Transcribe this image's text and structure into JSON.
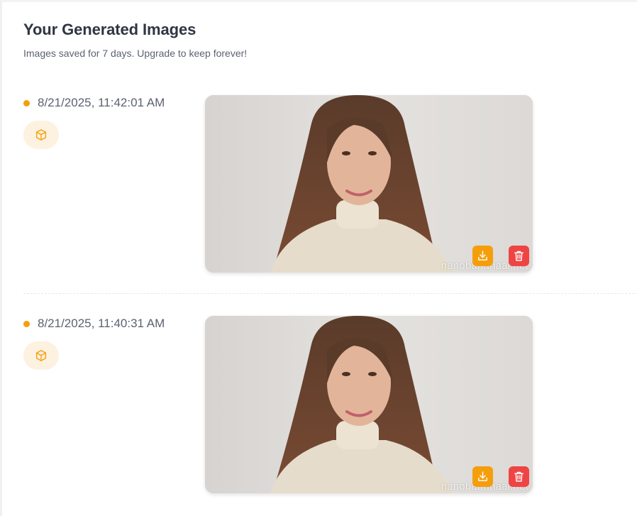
{
  "header": {
    "title": "Your Generated Images",
    "subtitle": "Images saved for 7 days. Upgrade to keep forever!"
  },
  "entries": [
    {
      "timestamp": "8/21/2025, 11:42:01 AM",
      "model_icon": "cube-icon",
      "watermark": "nanobananaai.net",
      "actions": {
        "download_icon": "download-icon",
        "delete_icon": "trash-icon"
      }
    },
    {
      "timestamp": "8/21/2025, 11:40:31 AM",
      "model_icon": "cube-icon",
      "watermark": "nanobananaai.net",
      "actions": {
        "download_icon": "download-icon",
        "delete_icon": "trash-icon"
      }
    }
  ],
  "colors": {
    "accent": "#f59e0b",
    "danger": "#ef4444",
    "badge_bg": "#fdf1e0",
    "title": "#2f3542",
    "muted": "#5b6270"
  }
}
